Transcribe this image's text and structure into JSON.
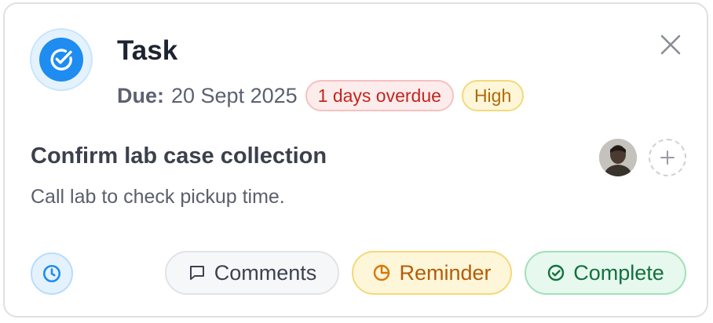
{
  "task": {
    "header": "Task",
    "due_label": "Due:",
    "due_date": "20 Sept 2025",
    "overdue_badge": "1 days overdue",
    "priority_badge": "High",
    "name": "Confirm lab case collection",
    "description": "Call lab to check pickup time."
  },
  "actions": {
    "comments": "Comments",
    "reminder": "Reminder",
    "complete": "Complete"
  },
  "icons": {
    "task": "check-circle-icon",
    "close": "close-icon",
    "add_assignee": "plus-icon",
    "clock": "clock-icon",
    "comments": "message-square-icon",
    "reminder": "timer-icon",
    "complete": "check-circle-icon"
  },
  "colors": {
    "accent_blue": "#1e8cf0",
    "overdue_red": "#c0271f",
    "priority_amber": "#b06a05",
    "complete_green": "#12723e"
  }
}
